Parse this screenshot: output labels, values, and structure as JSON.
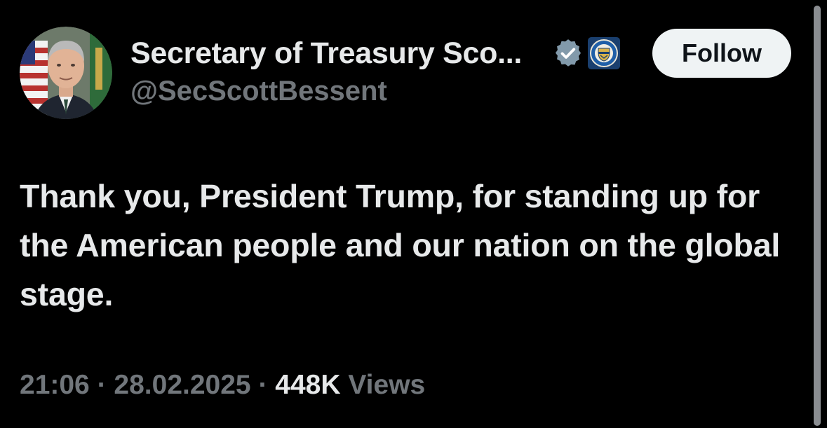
{
  "author": {
    "display_name": "Secretary of Treasury Sco...",
    "handle": "@SecScottBessent",
    "avatar_icon": "profile-photo",
    "verified_icon": "verified-badge-icon",
    "affiliation_icon": "treasury-seal-icon"
  },
  "actions": {
    "follow_label": "Follow"
  },
  "tweet": {
    "text": "Thank you, President Trump, for standing up for the American people and our nation on the global stage."
  },
  "meta": {
    "time": "21:06",
    "separator": " · ",
    "date": "28.02.2025",
    "views_count": "448K",
    "views_label": "Views"
  },
  "colors": {
    "background": "#000000",
    "primary_text": "#e7e9ea",
    "secondary_text": "#71767b",
    "follow_bg": "#eff3f4",
    "follow_text": "#0f1419",
    "verified_badge": "#829aab"
  }
}
